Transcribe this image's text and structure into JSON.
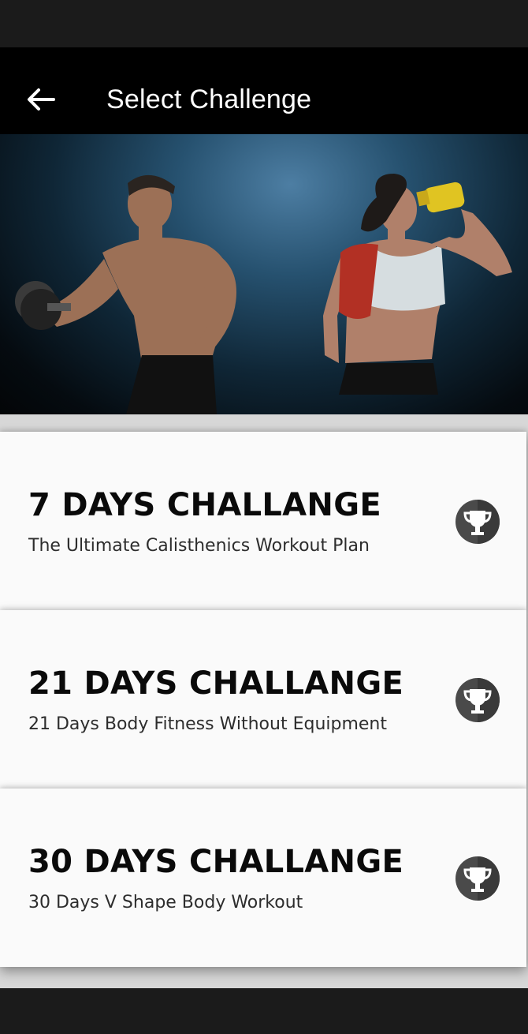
{
  "app_bar": {
    "title": "Select Challenge",
    "back_icon": "arrow-left-icon"
  },
  "hero": {
    "description": "athletes-banner-image"
  },
  "challenges": [
    {
      "title": "7 DAYS CHALLANGE",
      "subtitle": "The Ultimate Calisthenics Workout Plan",
      "icon": "trophy-icon"
    },
    {
      "title": "21 DAYS CHALLANGE",
      "subtitle": "21 Days Body Fitness Without Equipment",
      "icon": "trophy-icon"
    },
    {
      "title": "30 DAYS CHALLANGE",
      "subtitle": "30 Days V Shape Body Workout",
      "icon": "trophy-icon"
    }
  ],
  "colors": {
    "app_bar": "#000000",
    "card": "#fafafa",
    "trophy_bg": "#4a4a4a"
  }
}
